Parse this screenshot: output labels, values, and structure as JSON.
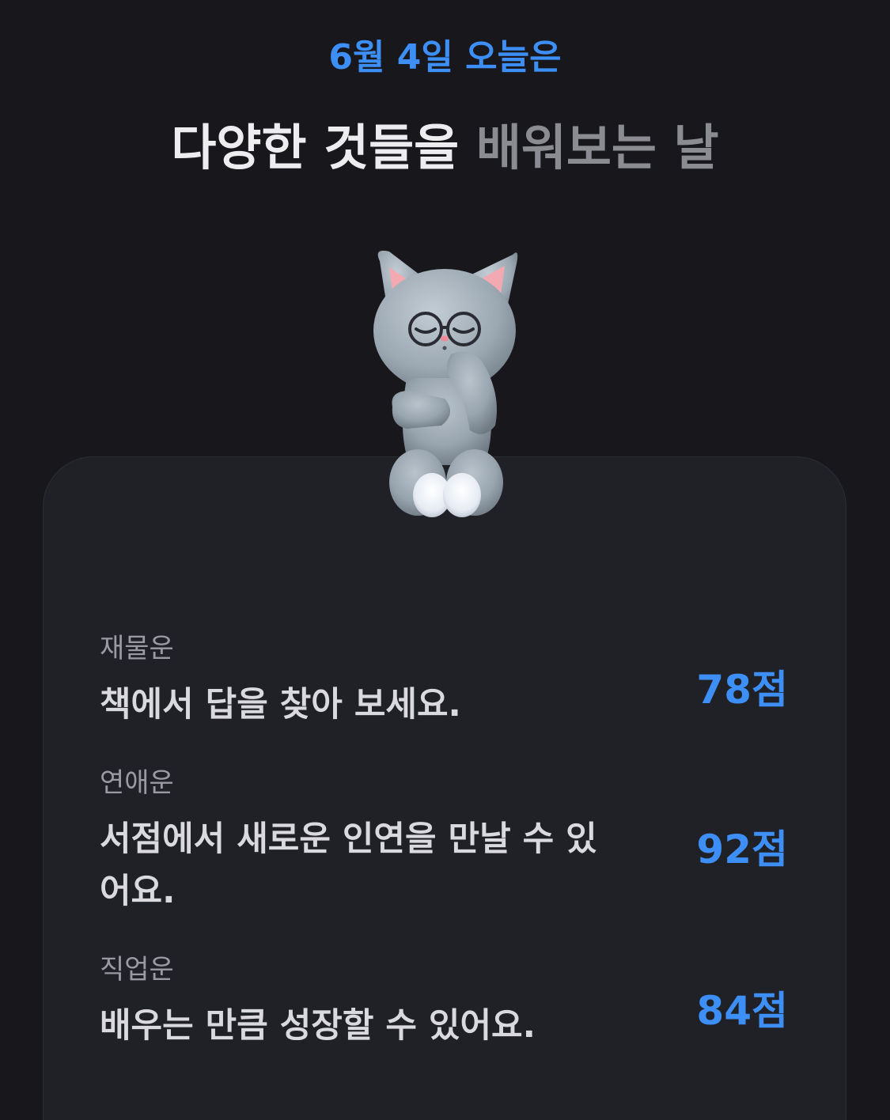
{
  "header": {
    "date_line": "6월 4일 오늘은",
    "headline_bright": "다양한 것들을 ",
    "headline_dim": "배워보는 날"
  },
  "mascot": {
    "icon": "gray-cat-with-glasses-icon"
  },
  "fortunes": [
    {
      "category": "재물운",
      "description": "책에서 답을 찾아 보세요.",
      "score": "78점"
    },
    {
      "category": "연애운",
      "description": "서점에서 새로운 인연을 만날 수 있어요.",
      "score": "92점"
    },
    {
      "category": "직업운",
      "description": "배우는 만큼 성장할 수 있어요.",
      "score": "84점"
    }
  ],
  "colors": {
    "background": "#17171c",
    "card": "#202027",
    "accent": "#3d8ff6",
    "primary_text": "#ededf0",
    "secondary_text": "#9a9aa3"
  }
}
